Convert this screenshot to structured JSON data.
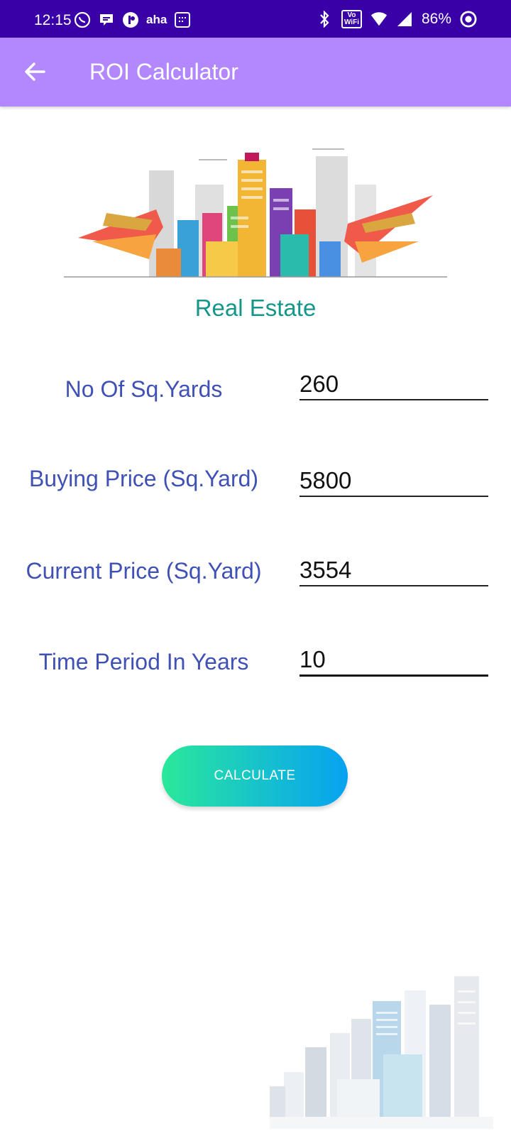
{
  "status_bar": {
    "time": "12:15",
    "battery": "86%",
    "wifi_badge_top": "Vo",
    "wifi_badge_bottom": "WiFi",
    "app_label": "aha"
  },
  "app_bar": {
    "title": "ROI Calculator"
  },
  "section": {
    "title": "Real Estate"
  },
  "form": {
    "fields": [
      {
        "label": "No Of Sq.Yards",
        "value": "260"
      },
      {
        "label": "Buying Price (Sq.Yard)",
        "value": "5800"
      },
      {
        "label": "Current Price (Sq.Yard)",
        "value": "3554"
      },
      {
        "label": "Time Period In Years",
        "value": "10"
      }
    ]
  },
  "button": {
    "label": "CALCULATE"
  },
  "colors": {
    "status_bar": "#3a00a8",
    "app_bar": "#b388ff",
    "section_title": "#14968a",
    "label": "#3f51b5"
  }
}
